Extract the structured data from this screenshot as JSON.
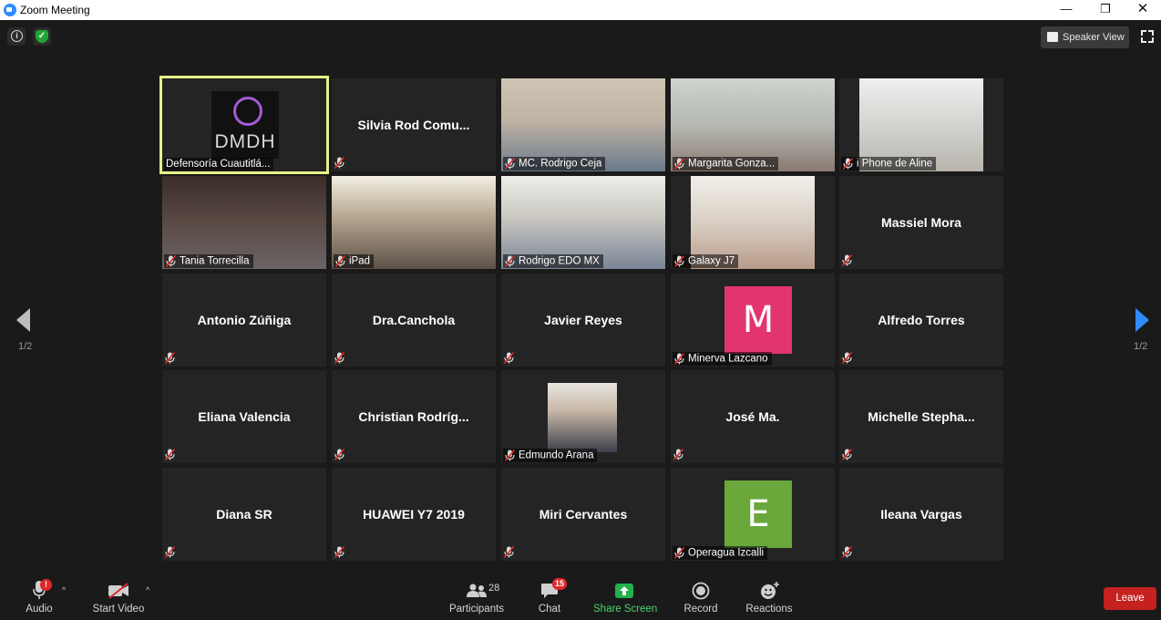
{
  "window": {
    "title": "Zoom Meeting",
    "minimize": "—",
    "maximize": "❐",
    "close": "✕"
  },
  "header": {
    "speaker_view_label": "Speaker View"
  },
  "pager": {
    "left_page": "1/2",
    "right_page": "1/2"
  },
  "logo_text": "DMDH",
  "avatar_colors": {
    "M": "#e2356e",
    "E": "#6aa83c"
  },
  "accent": "#2d8cff",
  "active_speaker_border": "#e8f08a",
  "participants": [
    {
      "name": "Defensoría Cuautitlá...",
      "kind": "logo"
    },
    {
      "name": "Silvia  Rod  Comu...",
      "kind": "name"
    },
    {
      "name": "MC. Rodrigo Ceja",
      "kind": "video"
    },
    {
      "name": "Margarita Gonza...",
      "kind": "video"
    },
    {
      "name": "i Phone de Aline",
      "kind": "video"
    },
    {
      "name": "Tania Torrecilla",
      "kind": "video"
    },
    {
      "name": "iPad",
      "kind": "video"
    },
    {
      "name": "Rodrigo EDO MX",
      "kind": "video"
    },
    {
      "name": "Galaxy J7",
      "kind": "video"
    },
    {
      "name": "Massiel Mora",
      "kind": "name"
    },
    {
      "name": "Antonio Zúñiga",
      "kind": "name"
    },
    {
      "name": "Dra.Canchola",
      "kind": "name"
    },
    {
      "name": "Javier Reyes",
      "kind": "name"
    },
    {
      "name": "Minerva Lazcano",
      "kind": "avatar",
      "initial": "M"
    },
    {
      "name": "Alfredo Torres",
      "kind": "name"
    },
    {
      "name": "Eliana Valencia",
      "kind": "name"
    },
    {
      "name": "Christian  Rodríg...",
      "kind": "name"
    },
    {
      "name": "Edmundo Arana",
      "kind": "photo"
    },
    {
      "name": "José Ma.",
      "kind": "name"
    },
    {
      "name": "Michelle  Stepha...",
      "kind": "name"
    },
    {
      "name": "Diana SR",
      "kind": "name"
    },
    {
      "name": "HUAWEI Y7 2019",
      "kind": "name"
    },
    {
      "name": "Miri Cervantes",
      "kind": "name"
    },
    {
      "name": "Operagua Izcalli",
      "kind": "avatar",
      "initial": "E"
    },
    {
      "name": "Ileana Vargas",
      "kind": "name"
    }
  ],
  "toolbar": {
    "audio_label": "Audio",
    "audio_alert": "!",
    "start_video_label": "Start Video",
    "participants_label": "Participants",
    "participants_count": "28",
    "chat_label": "Chat",
    "chat_badge": "15",
    "share_screen_label": "Share Screen",
    "record_label": "Record",
    "reactions_label": "Reactions",
    "leave_label": "Leave"
  }
}
